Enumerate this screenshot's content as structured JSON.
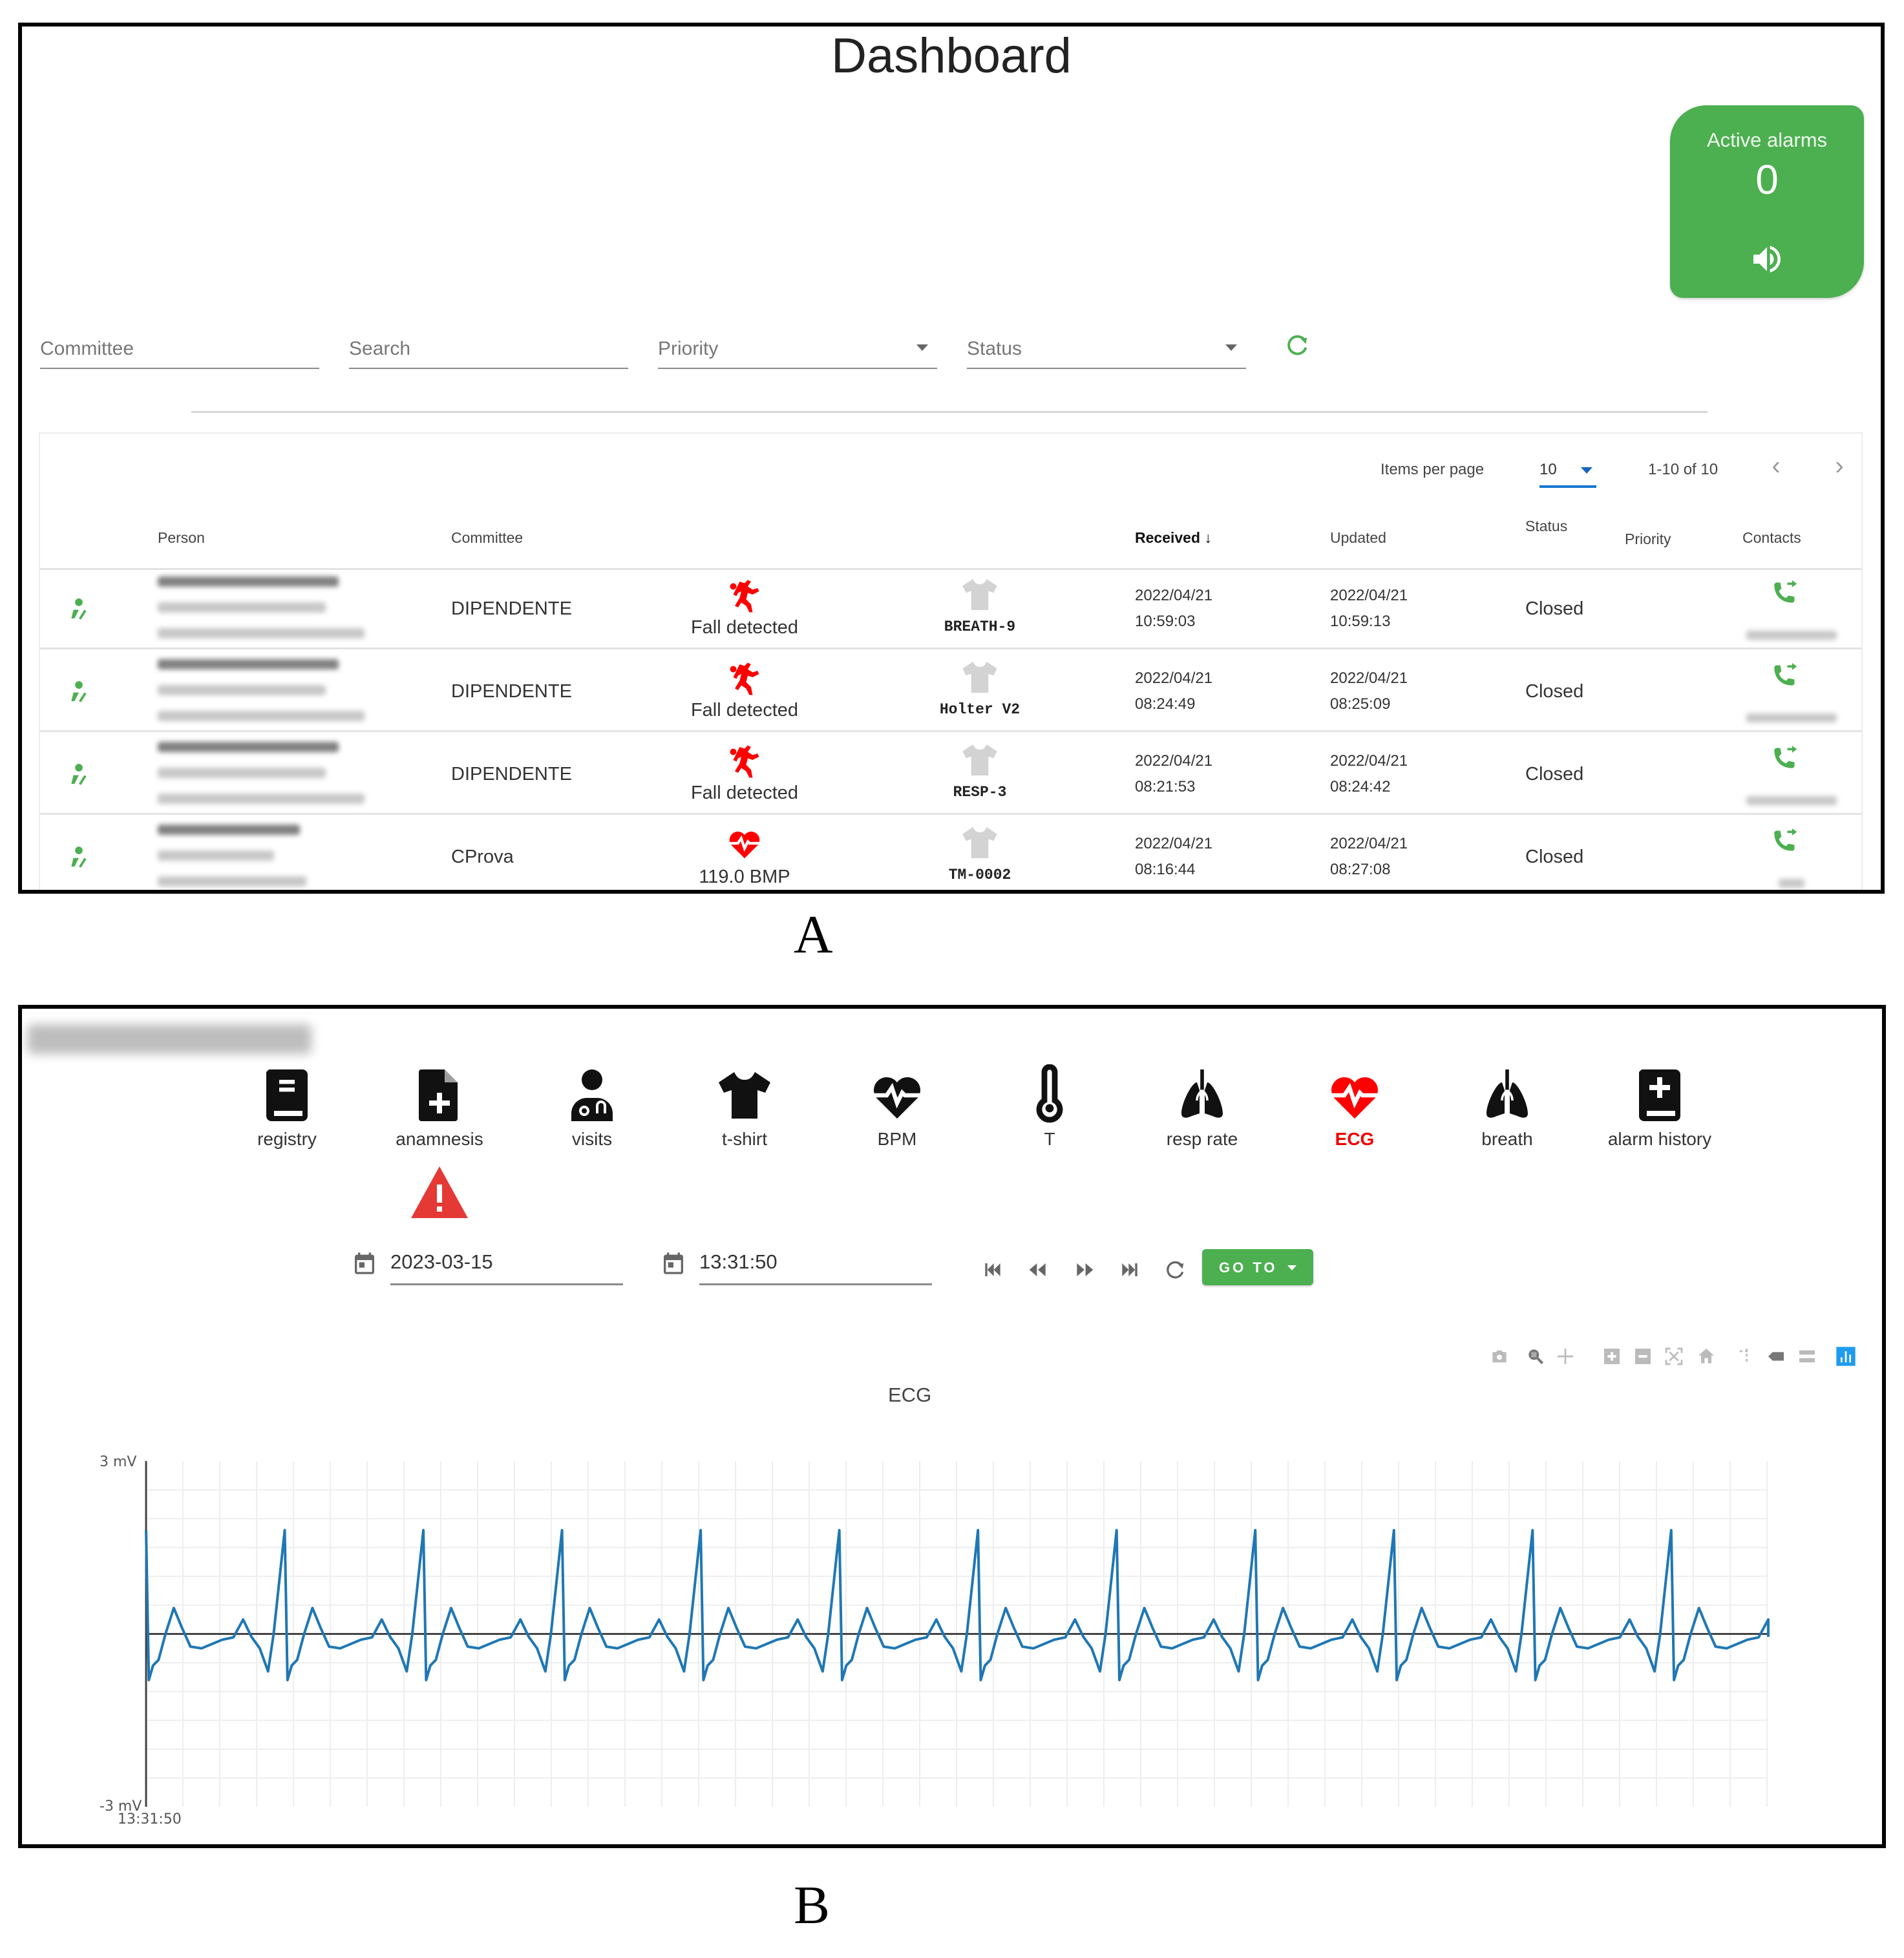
{
  "panel_labels": {
    "a": "A",
    "b": "B"
  },
  "dashboard": {
    "title": "Dashboard",
    "active_alarms": {
      "label": "Active alarms",
      "count": "0",
      "icon": "volume-up-icon",
      "color": "#4caf50"
    },
    "filters": {
      "committee_placeholder": "Committee",
      "search_placeholder": "Search",
      "priority_placeholder": "Priority",
      "status_placeholder": "Status",
      "refresh_icon": "refresh-icon"
    },
    "pagination": {
      "items_per_page_label": "Items per page",
      "items_per_page_value": "10",
      "range_label": "1-10 of 10",
      "prev_icon": "chevron-left-icon",
      "next_icon": "chevron-right-icon"
    },
    "columns": {
      "person": "Person",
      "committee": "Committee",
      "received": "Received",
      "updated": "Updated",
      "status": "Status",
      "priority": "Priority",
      "contacts": "Contacts"
    },
    "rows": [
      {
        "committee": "DIPENDENTE",
        "alert_icon": "fall-icon",
        "alert": "Fall detected",
        "device": "BREATH-9",
        "received_date": "2022/04/21",
        "received_time": "10:59:03",
        "updated_date": "2022/04/21",
        "updated_time": "10:59:13",
        "status": "Closed"
      },
      {
        "committee": "DIPENDENTE",
        "alert_icon": "fall-icon",
        "alert": "Fall detected",
        "device": "Holter V2",
        "received_date": "2022/04/21",
        "received_time": "08:24:49",
        "updated_date": "2022/04/21",
        "updated_time": "08:25:09",
        "status": "Closed"
      },
      {
        "committee": "DIPENDENTE",
        "alert_icon": "fall-icon",
        "alert": "Fall detected",
        "device": "RESP-3",
        "received_date": "2022/04/21",
        "received_time": "08:21:53",
        "updated_date": "2022/04/21",
        "updated_time": "08:24:42",
        "status": "Closed"
      },
      {
        "committee": "CProva",
        "alert_icon": "heart-pulse-icon",
        "alert": "119.0 BMP",
        "device": "TM-0002",
        "received_date": "2022/04/21",
        "received_time": "08:16:44",
        "updated_date": "2022/04/21",
        "updated_time": "08:27:08",
        "status": "Closed"
      }
    ],
    "colors": {
      "accent_green": "#4caf50",
      "alert_red": "#ff0000",
      "device_gray": "#d3d3d3",
      "pager_blue": "#1976d2"
    }
  },
  "patient": {
    "nav": [
      {
        "label": "registry",
        "icon": "book-icon"
      },
      {
        "label": "anamnesis",
        "icon": "file-medical-icon",
        "warning": true
      },
      {
        "label": "visits",
        "icon": "doctor-icon"
      },
      {
        "label": "t-shirt",
        "icon": "tshirt-icon"
      },
      {
        "label": "BPM",
        "icon": "heart-pulse-icon"
      },
      {
        "label": "T",
        "icon": "thermometer-icon"
      },
      {
        "label": "resp rate",
        "icon": "lungs-icon"
      },
      {
        "label": "ECG",
        "icon": "heart-pulse-icon",
        "active": true
      },
      {
        "label": "breath",
        "icon": "lungs-icon"
      },
      {
        "label": "alarm history",
        "icon": "medical-book-icon"
      }
    ],
    "date_value": "2023-03-15",
    "time_value": "13:31:50",
    "goto_label": "GO TO",
    "modebar": [
      "camera-icon",
      "zoom-icon",
      "pan-icon",
      "zoom-in-icon",
      "zoom-out-icon",
      "autoscale-icon",
      "home-icon",
      "spike-lines-icon",
      "hover-closest-icon",
      "hover-compare-icon",
      "plotly-logo-icon"
    ]
  },
  "chart_data": {
    "type": "line",
    "title": "ECG",
    "xlabel": "",
    "ylabel": "",
    "y_tick_labels": [
      "3 mV",
      "-3 mV"
    ],
    "x_tick_labels": [
      "13:31:50"
    ],
    "ylim": [
      -3,
      3
    ],
    "grid": true,
    "series": [
      {
        "name": "ECG",
        "color": "#1f77b4",
        "beats": 12,
        "r_peak_mV": 1.8,
        "s_trough_mV": -0.8,
        "t_wave_mV": 0.45,
        "p_wave_mV": 0.25,
        "baseline_mV": 0
      }
    ],
    "note": "Regular sinus rhythm, ~12 evenly spaced QRS complexes across the window"
  }
}
